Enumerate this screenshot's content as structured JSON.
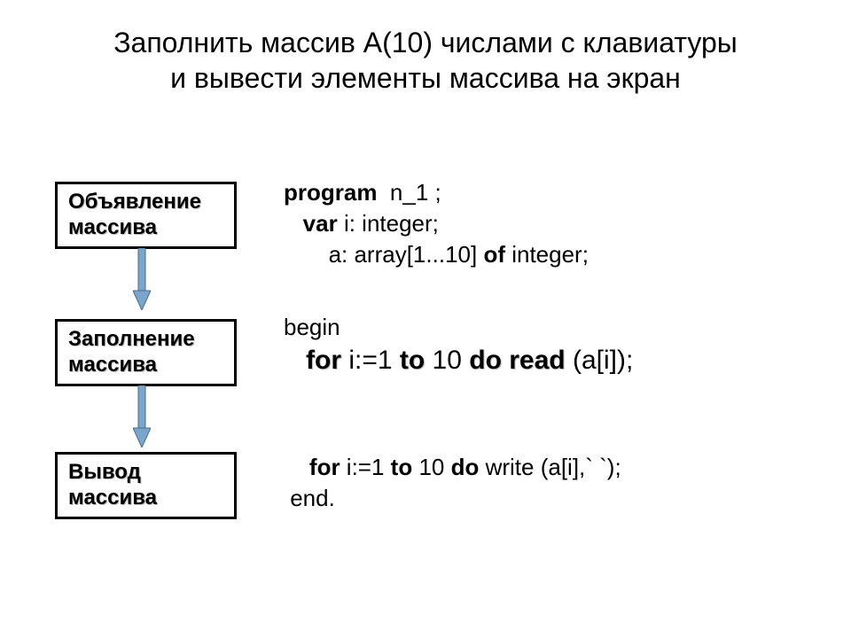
{
  "title_line1": "Заполнить массив А(10) числами с клавиатуры",
  "title_line2": "и вывести элементы массива на экран",
  "boxes": {
    "b1_l1": "Объявление",
    "b1_l2": "массива",
    "b2_l1": "Заполнение",
    "b2_l2": "массива",
    "b3_l1": "Вывод",
    "b3_l2": "массива"
  },
  "code1": {
    "kw_program": "program",
    "t1": "  n_1 ;",
    "pad_var": "   ",
    "kw_var": "var",
    "t2": " i: integer;",
    "t3": "       a: array[1...10] ",
    "kw_of": "of",
    "t4": " integer;"
  },
  "code2": {
    "t_begin": "begin",
    "pad": "   ",
    "kw_for": "for",
    "t_for_rest1": " i:=1 ",
    "kw_to": "to",
    "t_to_rest": " 10 ",
    "kw_do": "do read",
    "t_tail": " (a[i]);"
  },
  "code3": {
    "pad": "    ",
    "kw_for": "for",
    "t1": " i:=1 ",
    "kw_to": "to",
    "t2": " 10 ",
    "kw_do": "do",
    "t3": " write (a[i],` `);",
    "t_end": " end."
  }
}
